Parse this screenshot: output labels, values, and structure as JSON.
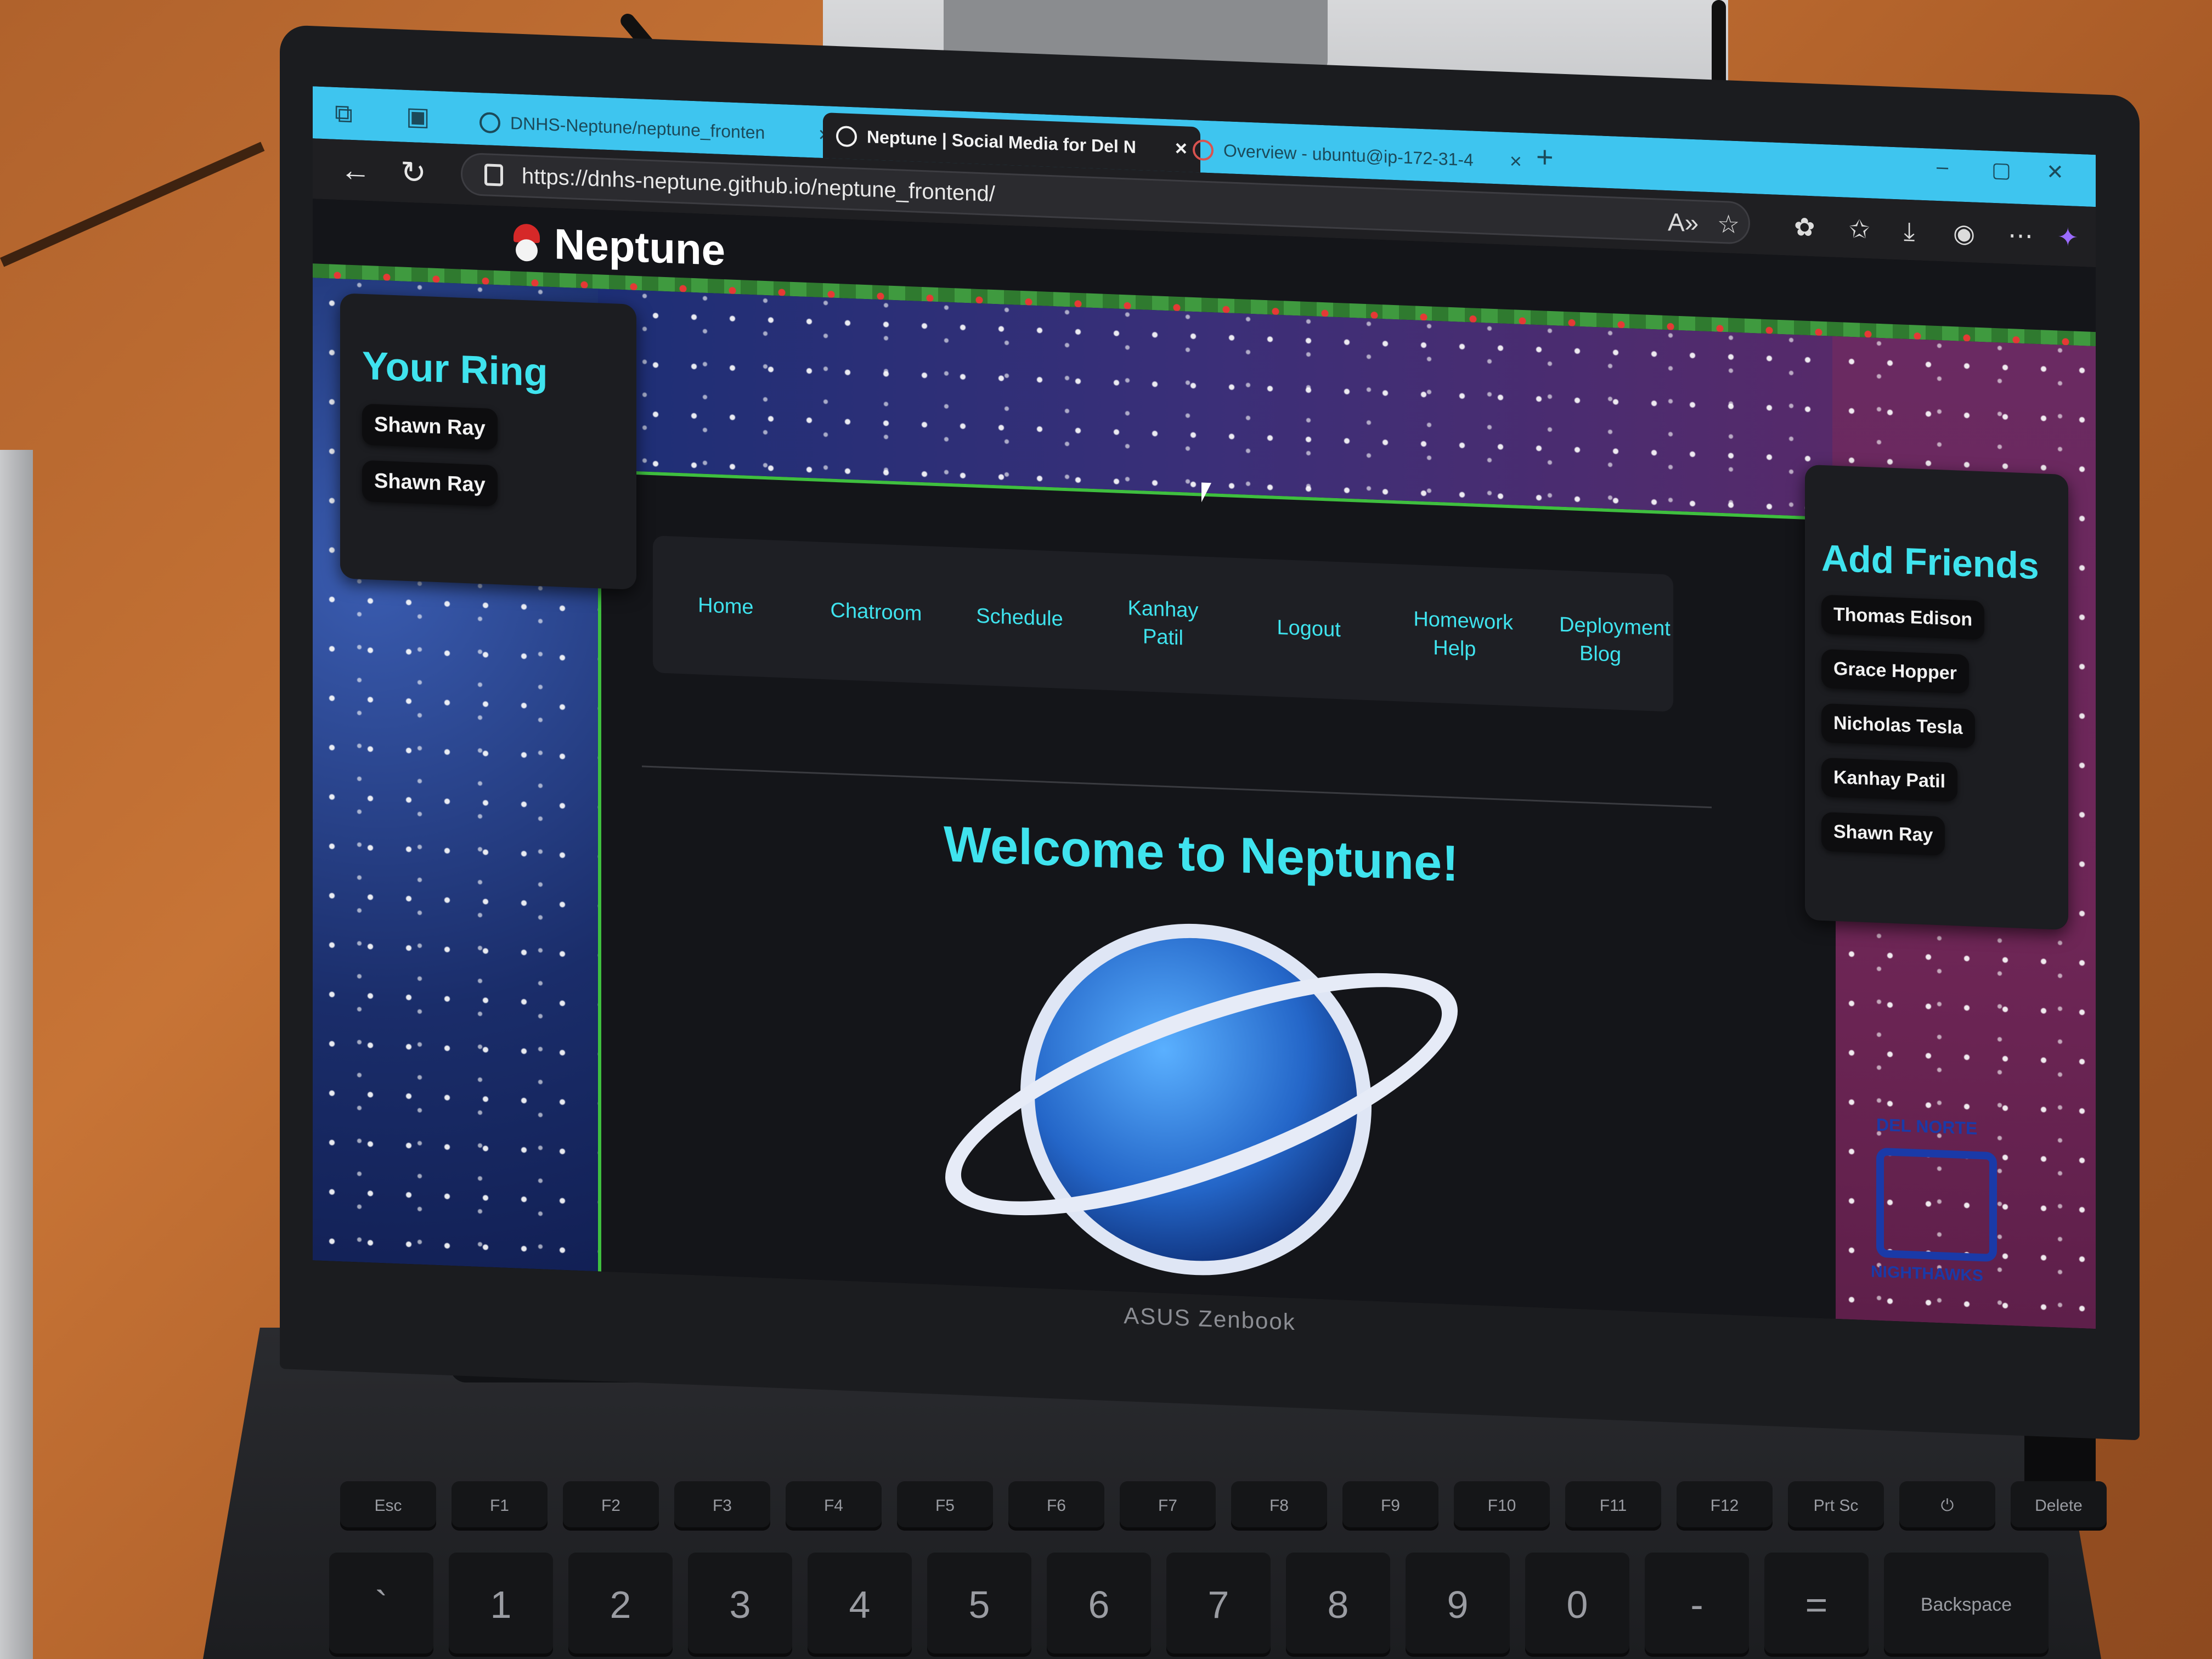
{
  "browser": {
    "tabs": [
      {
        "label": "DNHS-Neptune/neptune_fronten",
        "close": "×",
        "active": false
      },
      {
        "label": "Neptune | Social Media for Del N",
        "close": "×",
        "active": true
      },
      {
        "label": "Overview - ubuntu@ip-172-31-4",
        "close": "×",
        "active": false
      }
    ],
    "new_tab": "+",
    "url": "https://dnhs-neptune.github.io/neptune_frontend/",
    "window_controls": [
      "–",
      "▢",
      "✕"
    ]
  },
  "site": {
    "logo_text": "Neptune",
    "ring": {
      "title": "Your Ring",
      "members": [
        "Shawn Ray",
        "Shawn Ray"
      ]
    },
    "nav": [
      "Home",
      "Chatroom",
      "Schedule",
      "Kanhay Patil",
      "Logout",
      "Homework Help",
      "Deployment Blog"
    ],
    "friends": {
      "title": "Add Friends",
      "people": [
        "Thomas Edison",
        "Grace Hopper",
        "Nicholas Tesla",
        "Kanhay Patil",
        "Shawn Ray"
      ]
    },
    "welcome": "Welcome to Neptune!",
    "school_logo_text": [
      "DEL NORTE",
      "NIGHTHAWKS"
    ]
  },
  "laptop": {
    "brand": "ASUS Zenbook",
    "function_keys": [
      "Esc",
      "F1",
      "F2",
      "F3",
      "F4",
      "F5",
      "F6",
      "F7",
      "F8",
      "F9",
      "F10",
      "F11",
      "F12",
      "Prt Sc",
      "⏻",
      "Delete"
    ],
    "number_keys": [
      "`",
      "1",
      "2",
      "3",
      "4",
      "5",
      "6",
      "7",
      "8",
      "9",
      "0",
      "-",
      "=",
      "Backspace"
    ]
  },
  "colors": {
    "accent": "#3fe3ee",
    "tabbar": "#3ec5ef",
    "border_green": "#3fbf3f"
  }
}
